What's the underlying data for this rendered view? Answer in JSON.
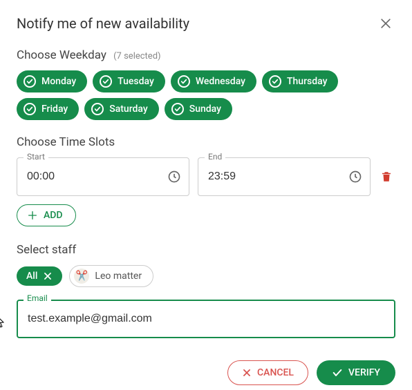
{
  "title": "Notify me of new availability",
  "weekday": {
    "label": "Choose Weekday",
    "selected_count": "(7 selected)",
    "days": [
      "Monday",
      "Tuesday",
      "Wednesday",
      "Thursday",
      "Friday",
      "Saturday",
      "Sunday"
    ]
  },
  "timeslots": {
    "label": "Choose Time Slots",
    "start_label": "Start",
    "end_label": "End",
    "start_value": "00:00",
    "end_value": "23:59",
    "add_label": "ADD"
  },
  "staff": {
    "label": "Select staff",
    "all_label": "All",
    "members": [
      {
        "name": "Leo matter",
        "avatar_emoji": "✂️"
      }
    ]
  },
  "email": {
    "label": "Email",
    "value": "test.example@gmail.com"
  },
  "actions": {
    "cancel": "CANCEL",
    "verify": "VERIFY"
  },
  "colors": {
    "primary": "#168c4b",
    "danger": "#d9534f"
  }
}
